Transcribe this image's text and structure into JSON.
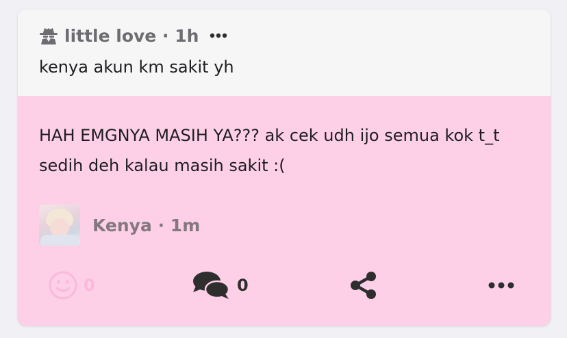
{
  "question": {
    "author": "little love",
    "separator": "·",
    "time": "1h",
    "text": "kenya akun km sakit yh"
  },
  "answer": {
    "text": "HAH EMGNYA MASIH YA??? ak cek udh ijo semua kok t_t sedih deh kalau masih sakit :(",
    "author": "Kenya",
    "time": "1m"
  },
  "actions": {
    "like_count": "0",
    "comment_count": "0"
  },
  "icons": {
    "anonymous": "spy-icon",
    "menu": "more-horizontal-icon",
    "like": "smiley-icon",
    "comment": "comments-icon",
    "share": "share-icon"
  },
  "colors": {
    "answer_background": "#fdd0e8",
    "question_background": "#f6f6f6",
    "like_pink": "#fbb8dc",
    "icon_dark": "#2e2e2e"
  }
}
